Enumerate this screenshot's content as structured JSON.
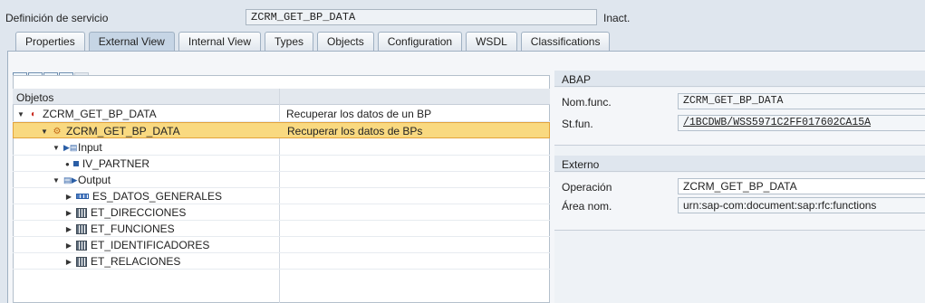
{
  "header": {
    "label": "Definición de servicio",
    "service_name": "ZCRM_GET_BP_DATA",
    "status": "Inact."
  },
  "tabs": [
    {
      "label": "Properties"
    },
    {
      "label": "External View"
    },
    {
      "label": "Internal View"
    },
    {
      "label": "Types"
    },
    {
      "label": "Objects"
    },
    {
      "label": "Configuration"
    },
    {
      "label": "WSDL"
    },
    {
      "label": "Classifications"
    }
  ],
  "toolbar": {
    "icons": [
      "expand-all-icon",
      "collapse-all-icon",
      "layout-icon",
      "find-icon",
      "find-next-icon"
    ]
  },
  "tree": {
    "column_header": "Objetos",
    "rows": [
      {
        "name": "ZCRM_GET_BP_DATA",
        "desc": "Recuperar los datos de un BP",
        "icon": "function-module-icon"
      },
      {
        "name": "ZCRM_GET_BP_DATA",
        "desc": "Recuperar los datos de BPs",
        "icon": "service-operation-icon"
      },
      {
        "name": "Input",
        "desc": "",
        "icon": "input-icon"
      },
      {
        "name": "IV_PARTNER",
        "desc": "",
        "icon": "field-icon"
      },
      {
        "name": "Output",
        "desc": "",
        "icon": "output-icon"
      },
      {
        "name": "ES_DATOS_GENERALES",
        "desc": "",
        "icon": "structure-icon"
      },
      {
        "name": "ET_DIRECCIONES",
        "desc": "",
        "icon": "table-icon"
      },
      {
        "name": "ET_FUNCIONES",
        "desc": "",
        "icon": "table-icon"
      },
      {
        "name": "ET_IDENTIFICADORES",
        "desc": "",
        "icon": "table-icon"
      },
      {
        "name": "ET_RELACIONES",
        "desc": "",
        "icon": "table-icon"
      }
    ]
  },
  "abap": {
    "title": "ABAP",
    "func_label": "Nom.func.",
    "func_value": "ZCRM_GET_BP_DATA",
    "stfun_label": "St.fun.",
    "stfun_value": "/1BCDWB/WSS5971C2FF017602CA15A"
  },
  "externo": {
    "title": "Externo",
    "op_label": "Operación",
    "op_value": "ZCRM_GET_BP_DATA",
    "ns_label": "Área nom.",
    "ns_value": "urn:sap-com:document:sap:rfc:functions"
  },
  "colors": {
    "highlight": "#f9d980",
    "active_tab": "#c6d5e5"
  }
}
